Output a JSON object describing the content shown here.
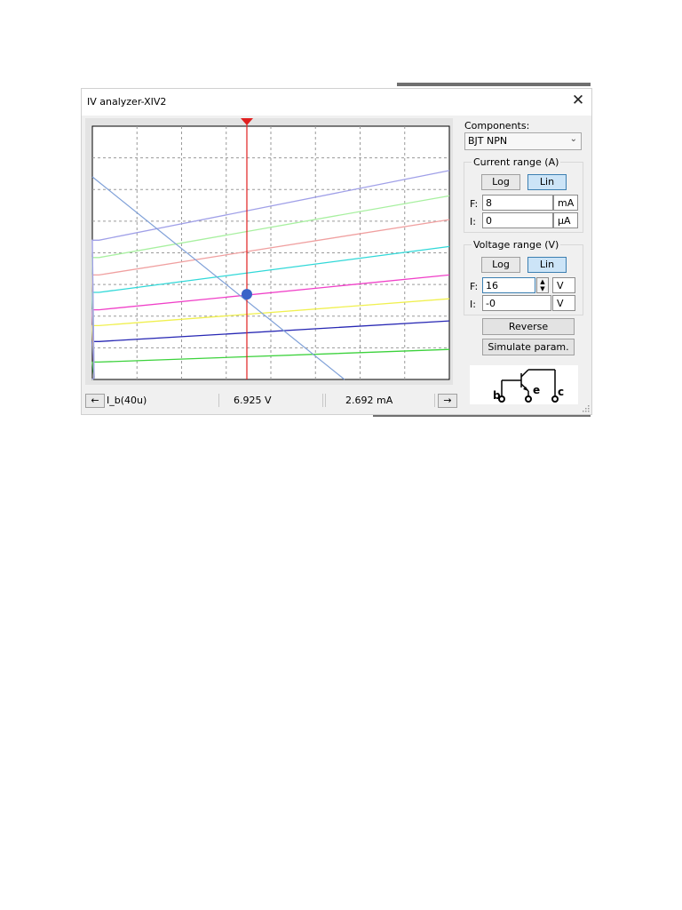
{
  "window": {
    "title": "IV analyzer-XIV2",
    "close_glyph": "✕"
  },
  "panel": {
    "components_label": "Components:",
    "component_selected": "BJT NPN",
    "current_range": {
      "title": "Current range (A)",
      "log_label": "Log",
      "lin_label": "Lin",
      "active_mode": "Lin",
      "f_label": "F:",
      "f_value": "8",
      "f_unit": "mA",
      "i_label": "I:",
      "i_value": "0",
      "i_unit": "µA"
    },
    "voltage_range": {
      "title": "Voltage range (V)",
      "log_label": "Log",
      "lin_label": "Lin",
      "active_mode": "Lin",
      "f_label": "F:",
      "f_value": "16",
      "f_unit": "V",
      "i_label": "I:",
      "i_value": "-0",
      "i_unit": "V"
    },
    "reverse_label": "Reverse",
    "simulate_label": "Simulate param.",
    "schematic_labels": {
      "b": "b",
      "e": "e",
      "c": "c"
    }
  },
  "status": {
    "left_arrow": "←",
    "curve_label": "I_b(40u)",
    "voltage_readout": "6.925  V",
    "current_readout": "2.692 mA",
    "right_arrow": "→"
  },
  "colors": {
    "cursor": "#e02020",
    "marker": "#3a64c8",
    "load_line": "#7fa0d8"
  },
  "chart_data": {
    "type": "line",
    "title": "",
    "xlabel": "",
    "ylabel": "",
    "xlim": [
      0,
      16
    ],
    "ylim": [
      0,
      8
    ],
    "grid": true,
    "cursor": {
      "x": 6.925,
      "y": 2.692
    },
    "series": [
      {
        "color": "#3cd23c",
        "points": [
          [
            0,
            0.55
          ],
          [
            0.3,
            0.55
          ],
          [
            16,
            0.95
          ]
        ]
      },
      {
        "color": "#2828b4",
        "points": [
          [
            0,
            1.2
          ],
          [
            0.3,
            1.2
          ],
          [
            16,
            1.85
          ]
        ]
      },
      {
        "color": "#f0f050",
        "points": [
          [
            0,
            1.7
          ],
          [
            0.3,
            1.7
          ],
          [
            16,
            2.55
          ]
        ]
      },
      {
        "color": "#f040c8",
        "points": [
          [
            0,
            2.2
          ],
          [
            0.3,
            2.2
          ],
          [
            16,
            3.3
          ]
        ]
      },
      {
        "color": "#30d8d8",
        "points": [
          [
            0,
            2.75
          ],
          [
            0.3,
            2.75
          ],
          [
            16,
            4.2
          ]
        ]
      },
      {
        "color": "#f0a0a0",
        "points": [
          [
            0,
            3.3
          ],
          [
            0.3,
            3.3
          ],
          [
            16,
            5.05
          ]
        ]
      },
      {
        "color": "#a8f0a0",
        "points": [
          [
            0,
            3.85
          ],
          [
            0.3,
            3.85
          ],
          [
            16,
            5.8
          ]
        ]
      },
      {
        "color": "#a0a0e8",
        "points": [
          [
            0,
            4.4
          ],
          [
            0.3,
            4.4
          ],
          [
            16,
            6.6
          ]
        ]
      }
    ],
    "load_line": [
      [
        0,
        6.4
      ],
      [
        11.3,
        0
      ]
    ]
  }
}
